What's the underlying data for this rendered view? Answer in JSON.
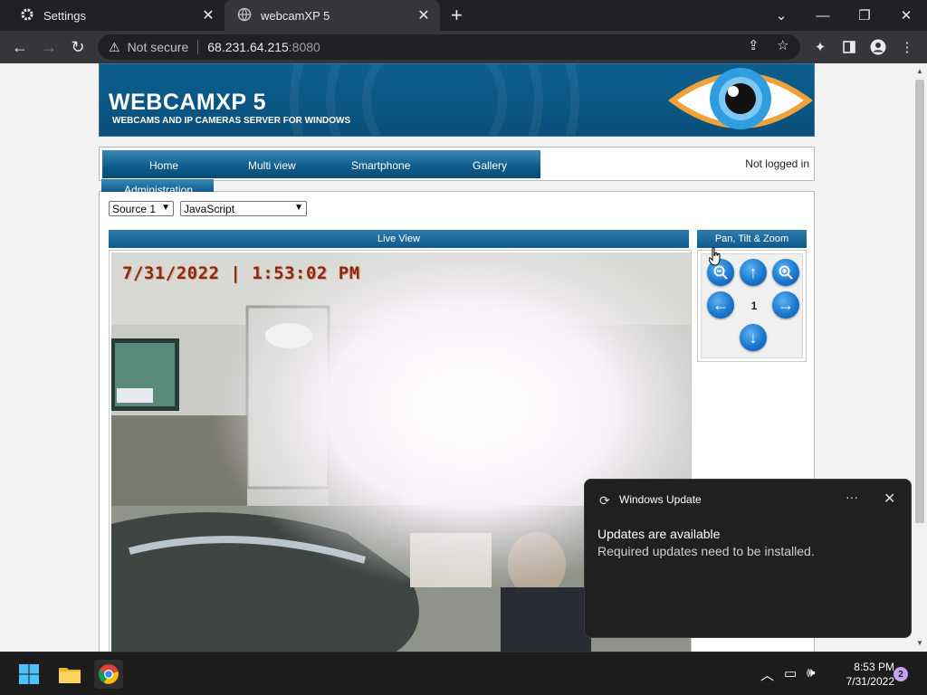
{
  "browser": {
    "tabs": [
      {
        "title": "Settings",
        "icon": "gear-icon",
        "active": false
      },
      {
        "title": "webcamXP 5",
        "icon": "globe-icon",
        "active": true
      }
    ],
    "address": {
      "security_label": "Not secure",
      "host": "68.231.64.215",
      "port": ":8080"
    }
  },
  "page": {
    "banner_title": "WEBCAMXP 5",
    "banner_subtitle": "WEBCAMS AND IP CAMERAS SERVER FOR WINDOWS",
    "nav": [
      "Home",
      "Multi view",
      "Smartphone",
      "Gallery",
      "Administration"
    ],
    "login_status": "Not logged in",
    "source_select": "Source 1",
    "mode_select": "JavaScript",
    "live_view_title": "Live View",
    "camera_timestamp": "7/31/2022 | 1:53:02 PM",
    "ptz_title": "Pan, Tilt & Zoom",
    "ptz_preset": "1"
  },
  "toast": {
    "app": "Windows Update",
    "title": "Updates are available",
    "body": "Required updates need to be installed."
  },
  "taskbar": {
    "time": "8:53 PM",
    "date": "7/31/2022",
    "notification_count": "2"
  },
  "colors": {
    "accent_blue": "#0b5a8b",
    "chrome_dark": "#202124",
    "toolbar": "#35363a"
  }
}
